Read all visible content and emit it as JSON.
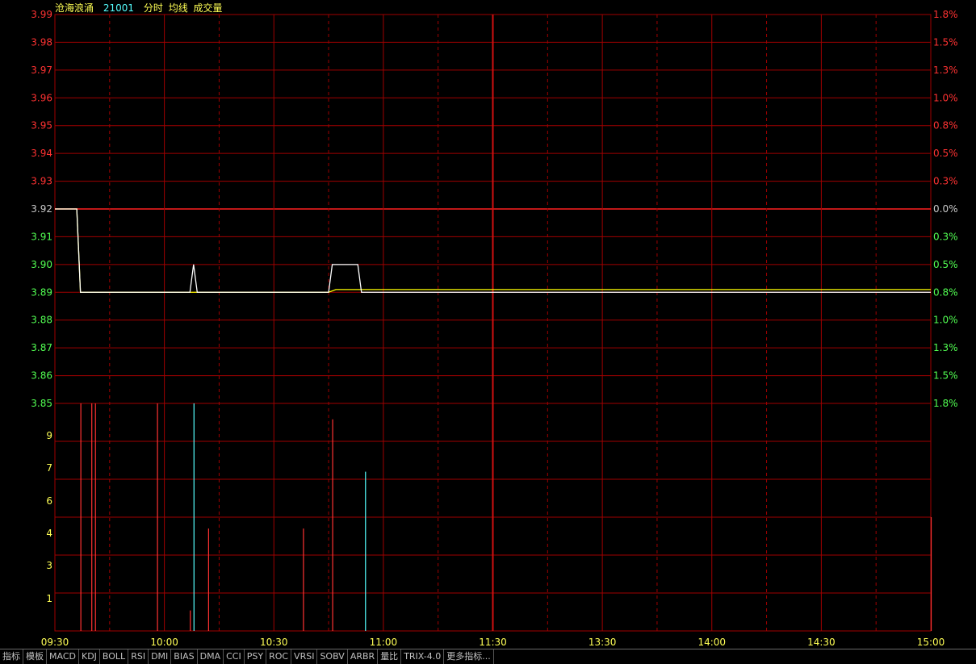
{
  "header": {
    "name": "沧海浪涌",
    "code": "21001",
    "labels": [
      "分时",
      "均线",
      "成交量"
    ]
  },
  "colors": {
    "bg": "#000000",
    "grid": "#a00000",
    "price_up": "#ff3232",
    "price_down": "#52ff52",
    "base_price": "#c8c8c8",
    "price_line": "#ffffff",
    "avg_line": "#ffff00",
    "vol_up": "#ff3232",
    "vol_down": "#55ffff",
    "vol_label": "#ffff55"
  },
  "chart_data": {
    "type": "line",
    "base_price": 3.92,
    "price_axis": {
      "ticks": [
        "3.99",
        "3.98",
        "3.97",
        "3.96",
        "3.95",
        "3.94",
        "3.93",
        "3.92",
        "3.91",
        "3.90",
        "3.89",
        "3.88",
        "3.87",
        "3.86",
        "3.85"
      ],
      "pct": [
        "1.8%",
        "1.5%",
        "1.3%",
        "1.0%",
        "0.8%",
        "0.5%",
        "0.3%",
        "0.0%",
        "0.3%",
        "0.5%",
        "0.8%",
        "1.0%",
        "1.3%",
        "1.5%",
        "1.8%"
      ]
    },
    "volume_axis": {
      "ticks": [
        "9",
        "7",
        "6",
        "4",
        "3",
        "1"
      ]
    },
    "time_axis": [
      "09:30",
      "10:00",
      "10:30",
      "11:00",
      "11:30",
      "13:30",
      "14:00",
      "14:30",
      "15:00"
    ],
    "price_series": [
      [
        0,
        3.92
      ],
      [
        6,
        3.92
      ],
      [
        7,
        3.89
      ],
      [
        37,
        3.89
      ],
      [
        38,
        3.9
      ],
      [
        39,
        3.89
      ],
      [
        75,
        3.89
      ],
      [
        76,
        3.9
      ],
      [
        83,
        3.9
      ],
      [
        84,
        3.89
      ],
      [
        240,
        3.89
      ]
    ],
    "avg_series": [
      [
        0,
        3.92
      ],
      [
        6,
        3.92
      ],
      [
        7,
        3.89
      ],
      [
        75,
        3.89
      ],
      [
        77,
        3.891
      ],
      [
        84,
        3.891
      ],
      [
        240,
        3.891
      ]
    ],
    "volume_bars": [
      {
        "t": 7,
        "v": 10,
        "dir": "up"
      },
      {
        "t": 10,
        "v": 10,
        "dir": "up"
      },
      {
        "t": 11,
        "v": 10,
        "dir": "up"
      },
      {
        "t": 28,
        "v": 10,
        "dir": "up"
      },
      {
        "t": 37,
        "v": 0.9,
        "dir": "up"
      },
      {
        "t": 38,
        "v": 10,
        "dir": "down"
      },
      {
        "t": 42,
        "v": 4.5,
        "dir": "up"
      },
      {
        "t": 68,
        "v": 4.5,
        "dir": "up"
      },
      {
        "t": 76,
        "v": 9.3,
        "dir": "up"
      },
      {
        "t": 85,
        "v": 7.0,
        "dir": "down"
      },
      {
        "t": 240,
        "v": 5.0,
        "dir": "up"
      }
    ]
  },
  "tabs": [
    "指标",
    "模板",
    "MACD",
    "KDJ",
    "BOLL",
    "RSI",
    "DMI",
    "BIAS",
    "DMA",
    "CCI",
    "PSY",
    "ROC",
    "VRSI",
    "SOBV",
    "ARBR",
    "量比",
    "TRIX-4.0",
    "更多指标..."
  ]
}
